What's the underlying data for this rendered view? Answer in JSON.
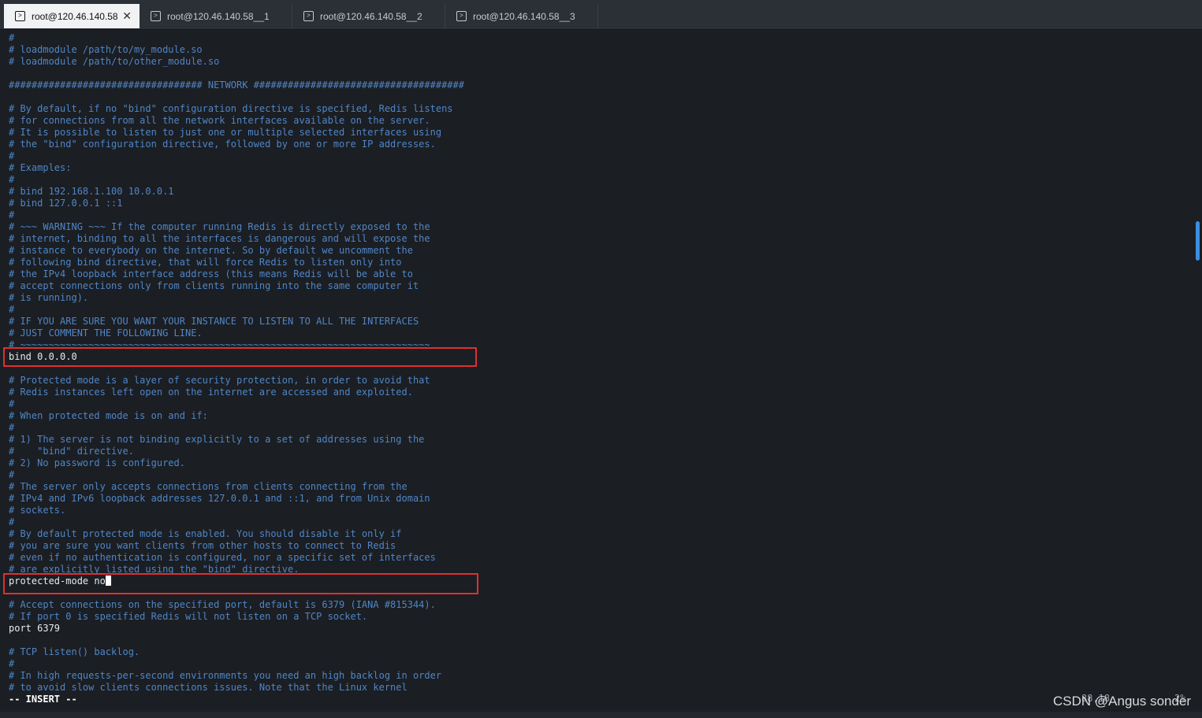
{
  "tabs": [
    {
      "label": "root@120.46.140.58",
      "active": true
    },
    {
      "label": "root@120.46.140.58__1",
      "active": false
    },
    {
      "label": "root@120.46.140.58__2",
      "active": false
    },
    {
      "label": "root@120.46.140.58__3",
      "active": false
    }
  ],
  "terminal": {
    "lines": [
      {
        "text": "#",
        "kind": "comment"
      },
      {
        "text": "# loadmodule /path/to/my_module.so",
        "kind": "comment"
      },
      {
        "text": "# loadmodule /path/to/other_module.so",
        "kind": "comment"
      },
      {
        "text": "",
        "kind": "blank"
      },
      {
        "text": "################################## NETWORK #####################################",
        "kind": "comment"
      },
      {
        "text": "",
        "kind": "blank"
      },
      {
        "text": "# By default, if no \"bind\" configuration directive is specified, Redis listens",
        "kind": "comment"
      },
      {
        "text": "# for connections from all the network interfaces available on the server.",
        "kind": "comment"
      },
      {
        "text": "# It is possible to listen to just one or multiple selected interfaces using",
        "kind": "comment"
      },
      {
        "text": "# the \"bind\" configuration directive, followed by one or more IP addresses.",
        "kind": "comment"
      },
      {
        "text": "#",
        "kind": "comment"
      },
      {
        "text": "# Examples:",
        "kind": "comment"
      },
      {
        "text": "#",
        "kind": "comment"
      },
      {
        "text": "# bind 192.168.1.100 10.0.0.1",
        "kind": "comment"
      },
      {
        "text": "# bind 127.0.0.1 ::1",
        "kind": "comment"
      },
      {
        "text": "#",
        "kind": "comment"
      },
      {
        "text": "# ~~~ WARNING ~~~ If the computer running Redis is directly exposed to the",
        "kind": "comment"
      },
      {
        "text": "# internet, binding to all the interfaces is dangerous and will expose the",
        "kind": "comment"
      },
      {
        "text": "# instance to everybody on the internet. So by default we uncomment the",
        "kind": "comment"
      },
      {
        "text": "# following bind directive, that will force Redis to listen only into",
        "kind": "comment"
      },
      {
        "text": "# the IPv4 loopback interface address (this means Redis will be able to",
        "kind": "comment"
      },
      {
        "text": "# accept connections only from clients running into the same computer it",
        "kind": "comment"
      },
      {
        "text": "# is running).",
        "kind": "comment"
      },
      {
        "text": "#",
        "kind": "comment"
      },
      {
        "text": "# IF YOU ARE SURE YOU WANT YOUR INSTANCE TO LISTEN TO ALL THE INTERFACES",
        "kind": "comment"
      },
      {
        "text": "# JUST COMMENT THE FOLLOWING LINE.",
        "kind": "comment"
      },
      {
        "text": "# ~~~~~~~~~~~~~~~~~~~~~~~~~~~~~~~~~~~~~~~~~~~~~~~~~~~~~~~~~~~~~~~~~~~~~~~~",
        "kind": "comment"
      },
      {
        "text": "bind 0.0.0.0",
        "kind": "code"
      },
      {
        "text": "",
        "kind": "blank"
      },
      {
        "text": "# Protected mode is a layer of security protection, in order to avoid that",
        "kind": "comment"
      },
      {
        "text": "# Redis instances left open on the internet are accessed and exploited.",
        "kind": "comment"
      },
      {
        "text": "#",
        "kind": "comment"
      },
      {
        "text": "# When protected mode is on and if:",
        "kind": "comment"
      },
      {
        "text": "#",
        "kind": "comment"
      },
      {
        "text": "# 1) The server is not binding explicitly to a set of addresses using the",
        "kind": "comment"
      },
      {
        "text": "#    \"bind\" directive.",
        "kind": "comment"
      },
      {
        "text": "# 2) No password is configured.",
        "kind": "comment"
      },
      {
        "text": "#",
        "kind": "comment"
      },
      {
        "text": "# The server only accepts connections from clients connecting from the",
        "kind": "comment"
      },
      {
        "text": "# IPv4 and IPv6 loopback addresses 127.0.0.1 and ::1, and from Unix domain",
        "kind": "comment"
      },
      {
        "text": "# sockets.",
        "kind": "comment"
      },
      {
        "text": "#",
        "kind": "comment"
      },
      {
        "text": "# By default protected mode is enabled. You should disable it only if",
        "kind": "comment"
      },
      {
        "text": "# you are sure you want clients from other hosts to connect to Redis",
        "kind": "comment"
      },
      {
        "text": "# even if no authentication is configured, nor a specific set of interfaces",
        "kind": "comment"
      },
      {
        "text": "# are explicitly listed using the \"bind\" directive.",
        "kind": "comment"
      },
      {
        "text": "protected-mode no",
        "kind": "code",
        "cursor": true
      },
      {
        "text": "",
        "kind": "blank"
      },
      {
        "text": "# Accept connections on the specified port, default is 6379 (IANA #815344).",
        "kind": "comment"
      },
      {
        "text": "# If port 0 is specified Redis will not listen on a TCP socket.",
        "kind": "comment"
      },
      {
        "text": "port 6379",
        "kind": "code"
      },
      {
        "text": "",
        "kind": "blank"
      },
      {
        "text": "# TCP listen() backlog.",
        "kind": "comment"
      },
      {
        "text": "#",
        "kind": "comment"
      },
      {
        "text": "# In high requests-per-second environments you need an high backlog in order",
        "kind": "comment"
      },
      {
        "text": "# to avoid slow clients connections issues. Note that the Linux kernel",
        "kind": "comment"
      },
      {
        "text": "-- INSERT --",
        "kind": "mode"
      }
    ]
  },
  "status": {
    "cursor_position": "88,18",
    "scroll_percent": "2%"
  },
  "watermark": "CSDN @Angus sonder",
  "colors": {
    "background": "#1b1e23",
    "comment": "#4f86c6",
    "code": "#e8eaed",
    "highlight_box": "#e03030",
    "scrollbar": "#3b8de0"
  }
}
